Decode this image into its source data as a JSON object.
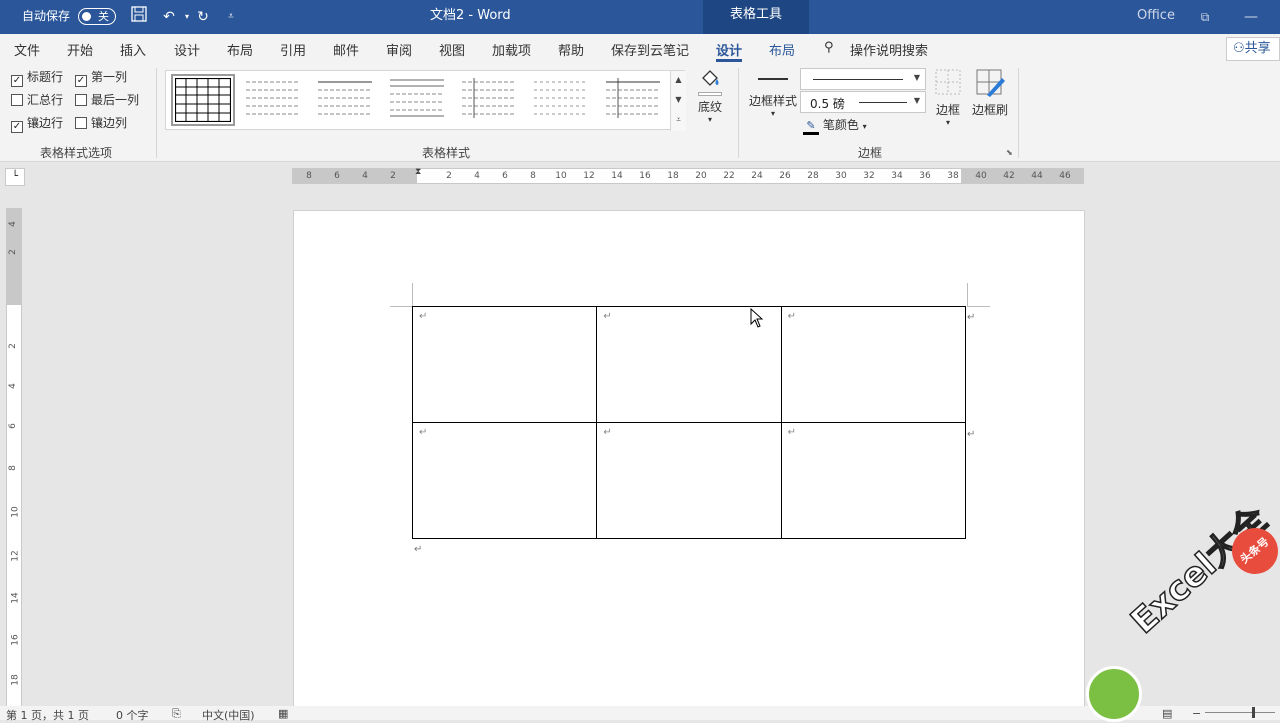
{
  "titlebar": {
    "autosave_label": "自动保存",
    "autosave_state": "关",
    "doc_title": "文档2 - Word",
    "context_tab": "表格工具",
    "account": "Office"
  },
  "menu": {
    "items": [
      "文件",
      "开始",
      "插入",
      "设计",
      "布局",
      "引用",
      "邮件",
      "审阅",
      "视图",
      "加载项",
      "帮助",
      "保存到云笔记",
      "设计",
      "布局"
    ],
    "active_index": 12,
    "search_label": "操作说明搜索",
    "share_label": "共享"
  },
  "ribbon": {
    "table_style_options": {
      "label": "表格样式选项",
      "options": [
        {
          "label": "标题行",
          "checked": true
        },
        {
          "label": "第一列",
          "checked": true
        },
        {
          "label": "汇总行",
          "checked": false
        },
        {
          "label": "最后一列",
          "checked": false
        },
        {
          "label": "镶边行",
          "checked": true
        },
        {
          "label": "镶边列",
          "checked": false
        }
      ]
    },
    "table_styles": {
      "label": "表格样式"
    },
    "shading": {
      "label": "底纹"
    },
    "borders": {
      "label": "边框",
      "border_styles_label": "边框样式",
      "weight_value": "0.5 磅",
      "pen_color_label": "笔颜色",
      "borders_btn_label": "边框",
      "border_painter_label": "边框刷"
    }
  },
  "rulers": {
    "horizontal": [
      "8",
      "6",
      "4",
      "2",
      "",
      "2",
      "4",
      "6",
      "8",
      "10",
      "12",
      "14",
      "16",
      "18",
      "20",
      "22",
      "24",
      "26",
      "28",
      "30",
      "32",
      "34",
      "36",
      "38",
      "40",
      "42",
      "44",
      "46"
    ],
    "vertical": [
      "4",
      "2",
      "",
      "2",
      "4",
      "6",
      "8",
      "10",
      "12",
      "14",
      "16",
      "18"
    ]
  },
  "document": {
    "rows": 2,
    "cols": 3,
    "para_mark": "↵"
  },
  "statusbar": {
    "page": "第 1 页，共 1 页",
    "words": "0 个字",
    "language": "中文(中国)"
  },
  "watermark": {
    "text": "Excel大全",
    "badge": "头条号"
  }
}
